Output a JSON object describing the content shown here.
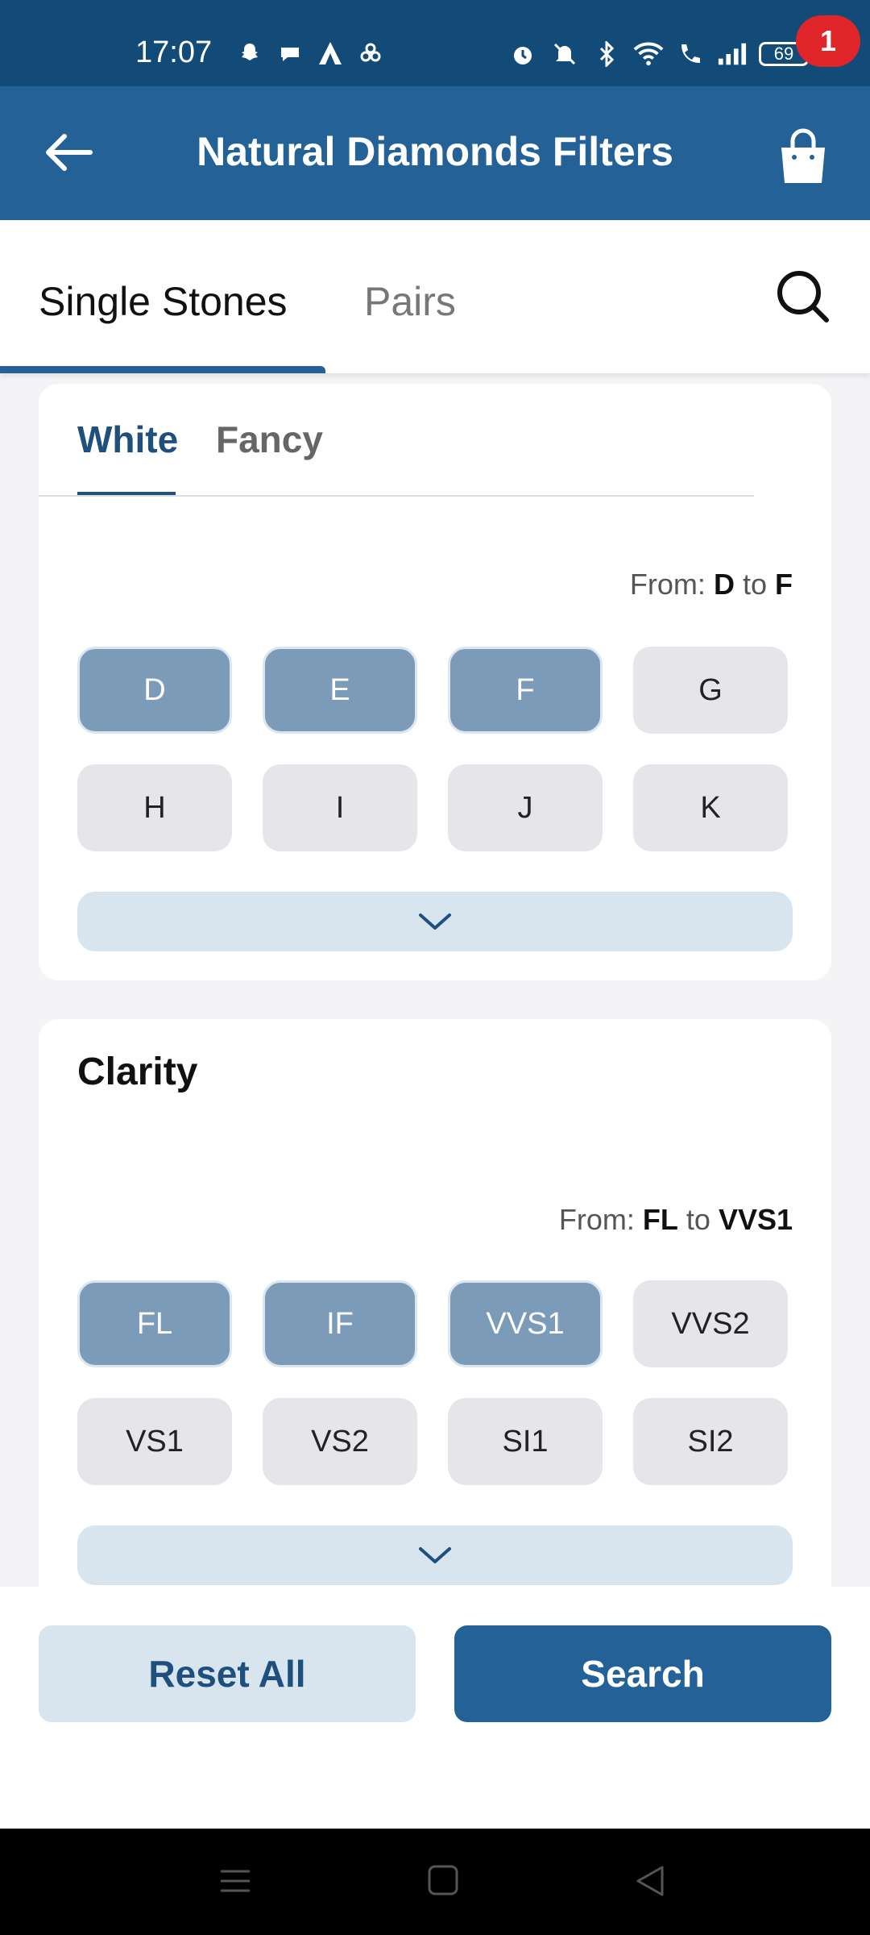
{
  "status_bar": {
    "time": "17:07",
    "battery": "69"
  },
  "app_bar": {
    "title": "Natural Diamonds Filters",
    "cart_count": "1"
  },
  "tabs": [
    {
      "label": "Single Stones"
    },
    {
      "label": "Pairs"
    }
  ],
  "color_section": {
    "subtabs": [
      {
        "label": "White"
      },
      {
        "label": "Fancy"
      }
    ],
    "range_prefix": "From:",
    "range_from": "D",
    "range_mid": "to",
    "range_to": "F",
    "chips": [
      "D",
      "E",
      "F",
      "G",
      "H",
      "I",
      "J",
      "K"
    ],
    "selected": [
      "D",
      "E",
      "F"
    ]
  },
  "clarity_section": {
    "title": "Clarity",
    "range_prefix": "From:",
    "range_from": "FL",
    "range_mid": "to",
    "range_to": "VVS1",
    "chips": [
      "FL",
      "IF",
      "VVS1",
      "VVS2",
      "VS1",
      "VS2",
      "SI1",
      "SI2"
    ],
    "selected": [
      "FL",
      "IF",
      "VVS1"
    ]
  },
  "footer": {
    "reset_label": "Reset All",
    "search_label": "Search"
  },
  "colors": {
    "primary": "#236196",
    "status": "#124a78",
    "selected_chip": "#7b9bb9",
    "badge": "#e0262b"
  },
  "icons": [
    "back-arrow-icon",
    "shopping-bag-icon",
    "search-icon",
    "chevron-down-icon",
    "menu-icon",
    "home-icon",
    "back-triangle-icon"
  ]
}
